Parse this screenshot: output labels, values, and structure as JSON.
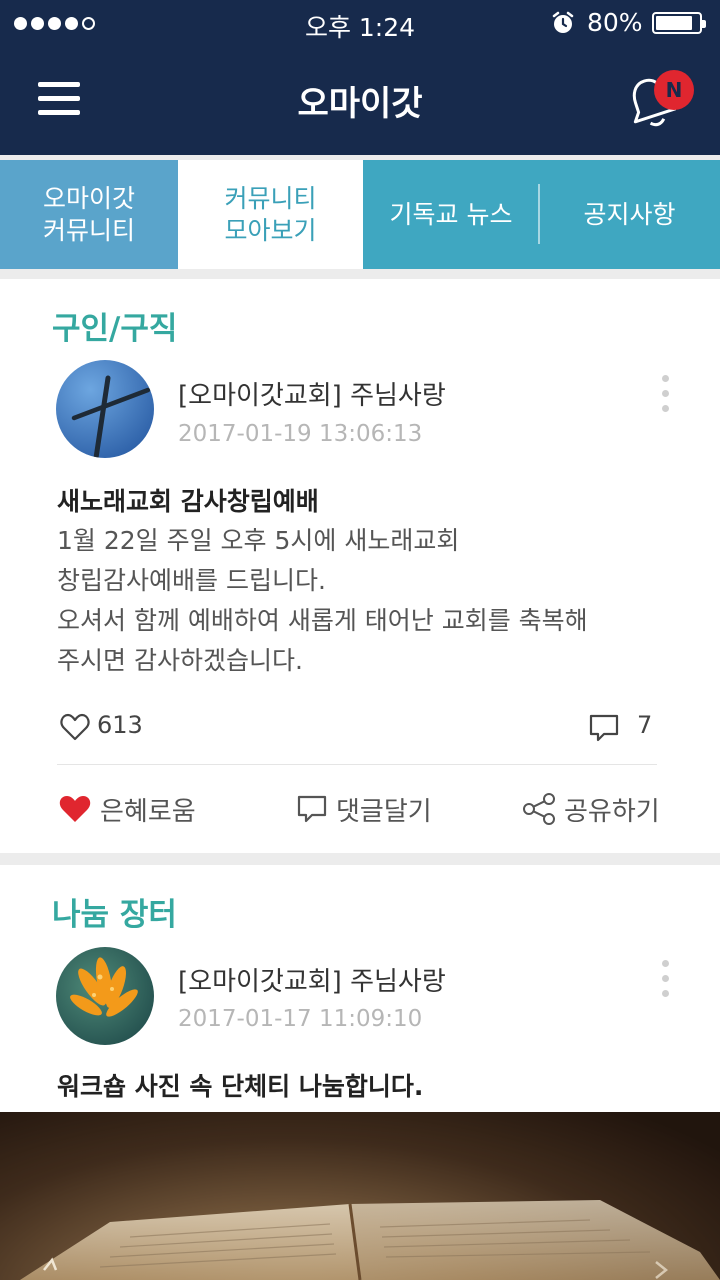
{
  "status_bar": {
    "time": "오후 1:24",
    "battery_percent": "80%",
    "signal_filled": 4,
    "signal_total": 5
  },
  "header": {
    "title": "오마이갓",
    "notification_badge": "N"
  },
  "tabs": [
    {
      "line1": "오마이갓",
      "line2": "커뮤니티",
      "active": false
    },
    {
      "line1": "커뮤니티",
      "line2": "모아보기",
      "active": true
    },
    {
      "line1": "기독교 뉴스",
      "line2": "",
      "active": false
    },
    {
      "line1": "공지사항",
      "line2": "",
      "active": false
    }
  ],
  "posts": [
    {
      "category": "구인/구직",
      "author": "[오마이갓교회] 주님사랑",
      "date": "2017-01-19 13:06:13",
      "title": "새노래교회 감사창립예배",
      "body": [
        "1월 22일 주일 오후 5시에 새노래교회",
        "창립감사예배를 드립니다.",
        "오셔서 함께 예배하여 새롭게 태어난 교회를 축복해",
        "주시면 감사하겠습니다."
      ],
      "likes": "613",
      "comments": "7",
      "actions": {
        "grace": "은혜로움",
        "comment": "댓글달기",
        "share": "공유하기"
      }
    },
    {
      "category": "나눔 장터",
      "author": "[오마이갓교회] 주님사랑",
      "date": "2017-01-17 11:09:10",
      "title": "워크숍 사진 속 단체티 나눔합니다."
    }
  ],
  "colors": {
    "navy": "#172a4c",
    "teal_tab": "#3fa7c1",
    "category_green": "#35a8a0",
    "heart_red": "#e0262f"
  }
}
